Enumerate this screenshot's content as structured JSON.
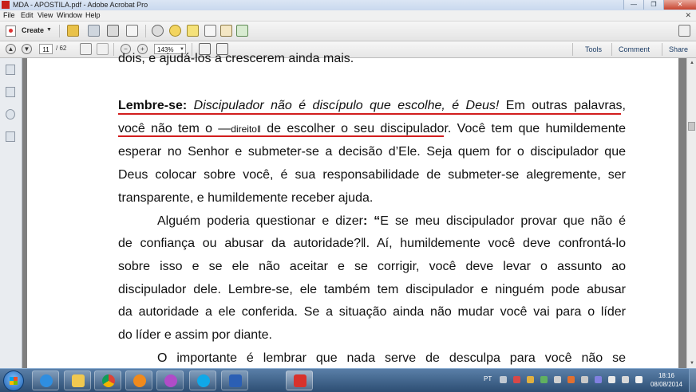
{
  "window": {
    "title": "MDA - APOSTILA.pdf - Adobe Acrobat Pro",
    "minimize": "—",
    "restore": "❐",
    "close": "✕"
  },
  "menu": {
    "items": [
      "File",
      "Edit",
      "View",
      "Window",
      "Help"
    ],
    "close_doc": "✕"
  },
  "toolbar": {
    "create_label": "Create",
    "page_current": "11",
    "page_total": "/ 62",
    "zoom": "143%",
    "tools_label": "Tools",
    "comment_label": "Comment",
    "share_label": "Share"
  },
  "document": {
    "line0": "dois, e ajudá-los a crescerem ainda mais.",
    "p1": {
      "lead": "Lembre-se:",
      "italic": " Discipulador não é discípulo que escolhe, é Deus!",
      "rest1": " Em outras palavras,",
      "l2a": "você não tem o ―",
      "l2b": "direito‖",
      "l2c": " de escolher o seu discipulador",
      "l2d": ". Você tem que humildemente",
      "l3": "esperar no Senhor e submeter-se a decisão d’Ele. Seja quem for o discipulador que",
      "l4": "Deus colocar sobre você, é sua responsabilidade de submeter-se alegremente, ser",
      "l5": "transparente, e humildemente receber ajuda."
    },
    "p2": {
      "l1a": "Alguém poderia questionar e dizer",
      "l1b": ": “",
      "l1c": "E se meu discipulador provar que não é",
      "l2": "de confiança ou abusar da autoridade?‖. Aí, humildemente você deve confrontá-lo",
      "l3": "sobre isso e se ele não aceitar e se corrigir, você deve levar o assunto ao",
      "l4": "discipulador dele. Lembre-se, ele também tem discipulador e ninguém pode abusar",
      "l5": "da autoridade a ele conferida. Se a situação ainda não mudar você vai para o líder",
      "l6": "do líder e assim por diante."
    },
    "p3": {
      "l1": "O importante é lembrar que nada serve de desculpa para você não se"
    }
  },
  "taskbar": {
    "language": "PT",
    "time": "18:16",
    "date": "08/08/2014",
    "apps": [
      "internet-explorer",
      "file-explorer",
      "chrome",
      "media-player",
      "itunes",
      "skype",
      "word",
      "acrobat"
    ]
  },
  "colors": {
    "underline": "#d21d1d",
    "acrobat_red": "#c8201c",
    "taskbar": "#2d4e73"
  }
}
